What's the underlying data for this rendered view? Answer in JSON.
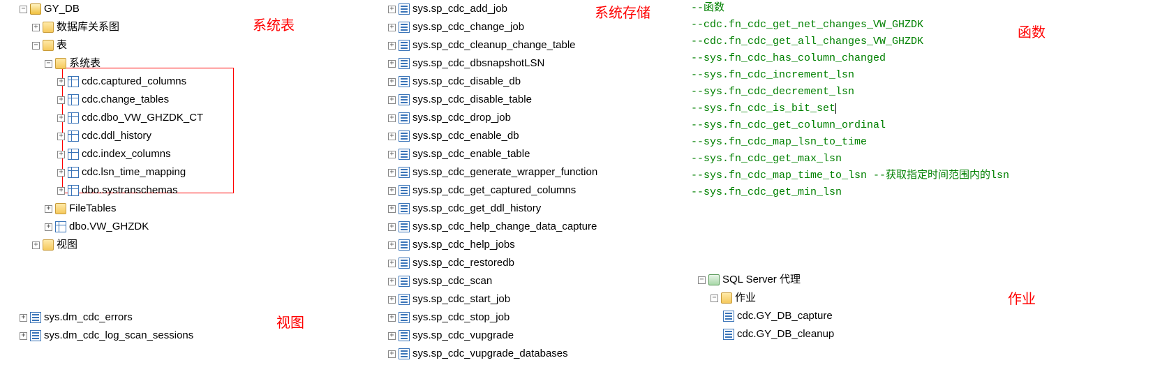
{
  "annotations": {
    "sys_tables": "系统表",
    "views": "视图",
    "sys_sp": "系统存储",
    "funcs": "函数",
    "jobs": "作业"
  },
  "tree1": {
    "db": "GY_DB",
    "diagram": "数据库关系图",
    "tables": "表",
    "sys_tables": "系统表",
    "sys_table_items": [
      "cdc.captured_columns",
      "cdc.change_tables",
      "cdc.dbo_VW_GHZDK_CT",
      "cdc.ddl_history",
      "cdc.index_columns",
      "cdc.lsn_time_mapping",
      "dbo.systranschemas"
    ],
    "filetables": "FileTables",
    "user_table": "dbo.VW_GHZDK",
    "views": "视图"
  },
  "views_items": [
    "sys.dm_cdc_errors",
    "sys.dm_cdc_log_scan_sessions"
  ],
  "sp_items": [
    "sys.sp_cdc_add_job",
    "sys.sp_cdc_change_job",
    "sys.sp_cdc_cleanup_change_table",
    "sys.sp_cdc_dbsnapshotLSN",
    "sys.sp_cdc_disable_db",
    "sys.sp_cdc_disable_table",
    "sys.sp_cdc_drop_job",
    "sys.sp_cdc_enable_db",
    "sys.sp_cdc_enable_table",
    "sys.sp_cdc_generate_wrapper_function",
    "sys.sp_cdc_get_captured_columns",
    "sys.sp_cdc_get_ddl_history",
    "sys.sp_cdc_help_change_data_capture",
    "sys.sp_cdc_help_jobs",
    "sys.sp_cdc_restoredb",
    "sys.sp_cdc_scan",
    "sys.sp_cdc_start_job",
    "sys.sp_cdc_stop_job",
    "sys.sp_cdc_vupgrade",
    "sys.sp_cdc_vupgrade_databases"
  ],
  "code_lines": [
    {
      "t": "--函数",
      "black": true
    },
    {
      "t": "--cdc.fn_cdc_get_net_changes_VW_GHZDK"
    },
    {
      "t": "--cdc.fn_cdc_get_all_changes_VW_GHZDK"
    },
    {
      "t": "--sys.fn_cdc_has_column_changed"
    },
    {
      "t": "--sys.fn_cdc_increment_lsn"
    },
    {
      "t": "--sys.fn_cdc_decrement_lsn"
    },
    {
      "t": "--sys.fn_cdc_is_bit_set",
      "cursor": true
    },
    {
      "t": "--sys.fn_cdc_get_column_ordinal"
    },
    {
      "t": "--sys.fn_cdc_map_lsn_to_time"
    },
    {
      "t": "--sys.fn_cdc_get_max_lsn"
    },
    {
      "t": "--sys.fn_cdc_map_time_to_lsn --获取指定时间范围内的lsn"
    },
    {
      "t": "--sys.fn_cdc_get_min_lsn"
    }
  ],
  "jobs": {
    "agent": "SQL Server 代理",
    "jobs_folder": "作业",
    "items": [
      "cdc.GY_DB_capture",
      "cdc.GY_DB_cleanup"
    ]
  }
}
